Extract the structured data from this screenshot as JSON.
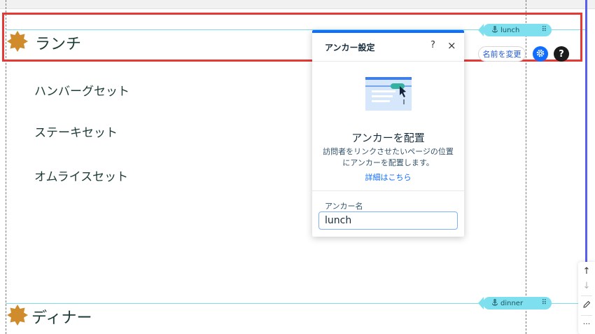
{
  "page": {
    "sections": [
      {
        "title": "ランチ",
        "anchor": "lunch"
      },
      {
        "title": "ディナー",
        "anchor": "dinner"
      }
    ],
    "lunch_items": [
      "ハンバーグセット",
      "ステーキセット",
      "オムライスセット"
    ]
  },
  "toolbar": {
    "rename_label": "名前を変更",
    "help_glyph": "?"
  },
  "panel": {
    "title": "アンカー設定",
    "help_glyph": "?",
    "close_glyph": "×",
    "subtitle": "アンカーを配置",
    "description_line1": "訪問者をリンクさせたいページの位置",
    "description_line2": "にアンカーを配置します。",
    "link": "詳細はこちら",
    "field_label": "アンカー名",
    "field_value": "lunch"
  },
  "side_tools": {
    "up_glyph": "↑",
    "down_glyph": "↓",
    "more_glyph": "···"
  },
  "colors": {
    "accent": "#116dff",
    "selection": "#e53935",
    "anchor_tag": "#7ee0ee",
    "badge": "#d08b2c",
    "heading_text": "#1c3b36"
  }
}
